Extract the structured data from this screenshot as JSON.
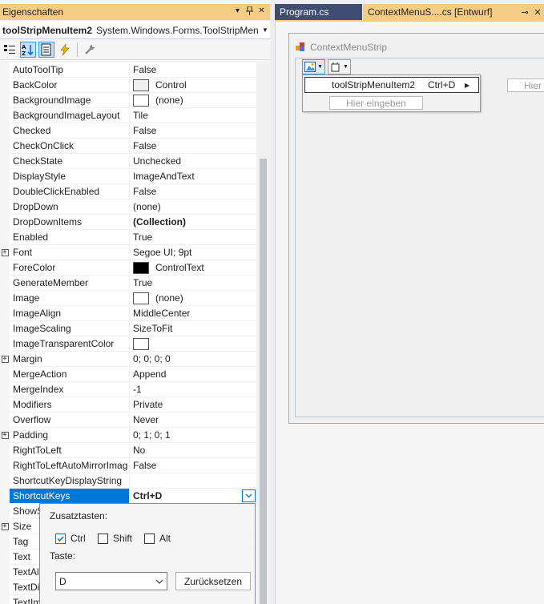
{
  "props_panel": {
    "title": "Eigenschaften",
    "object_name": "toolStripMenuItem2",
    "object_type": "System.Windows.Forms.ToolStripMen",
    "toolbar": [
      "categorized-icon",
      "alphabetical-icon",
      "properties-icon",
      "events-icon",
      "property-pages-icon"
    ],
    "rows": [
      {
        "name": "AutoToolTip",
        "value": "False"
      },
      {
        "name": "BackColor",
        "value": "Control",
        "swatch": "#f0f0f0"
      },
      {
        "name": "BackgroundImage",
        "value": "(none)",
        "swatch": "#ffffff"
      },
      {
        "name": "BackgroundImageLayout",
        "value": "Tile"
      },
      {
        "name": "Checked",
        "value": "False"
      },
      {
        "name": "CheckOnClick",
        "value": "False"
      },
      {
        "name": "CheckState",
        "value": "Unchecked"
      },
      {
        "name": "DisplayStyle",
        "value": "ImageAndText"
      },
      {
        "name": "DoubleClickEnabled",
        "value": "False"
      },
      {
        "name": "DropDown",
        "value": "(none)"
      },
      {
        "name": "DropDownItems",
        "value": "(Collection)",
        "bold": true
      },
      {
        "name": "Enabled",
        "value": "True"
      },
      {
        "name": "Font",
        "value": "Segoe UI; 9pt",
        "expandable": true
      },
      {
        "name": "ForeColor",
        "value": "ControlText",
        "swatch": "#000000"
      },
      {
        "name": "GenerateMember",
        "value": "True"
      },
      {
        "name": "Image",
        "value": "(none)",
        "swatch": "#ffffff"
      },
      {
        "name": "ImageAlign",
        "value": "MiddleCenter"
      },
      {
        "name": "ImageScaling",
        "value": "SizeToFit"
      },
      {
        "name": "ImageTransparentColor",
        "value": "",
        "swatch": "#ffffff"
      },
      {
        "name": "Margin",
        "value": "0; 0; 0; 0",
        "expandable": true
      },
      {
        "name": "MergeAction",
        "value": "Append"
      },
      {
        "name": "MergeIndex",
        "value": "-1"
      },
      {
        "name": "Modifiers",
        "value": "Private"
      },
      {
        "name": "Overflow",
        "value": "Never"
      },
      {
        "name": "Padding",
        "value": "0; 1; 0; 1",
        "expandable": true
      },
      {
        "name": "RightToLeft",
        "value": "No"
      },
      {
        "name": "RightToLeftAutoMirrorImag",
        "value": "False"
      },
      {
        "name": "ShortcutKeyDisplayString",
        "value": ""
      },
      {
        "name": "ShortcutKeys",
        "value": "Ctrl+D",
        "selected": true
      },
      {
        "name": "ShowS",
        "value": ""
      },
      {
        "name": "Size",
        "value": "",
        "expandable": true
      },
      {
        "name": "Tag",
        "value": ""
      },
      {
        "name": "Text",
        "value": ""
      },
      {
        "name": "TextAl",
        "value": ""
      },
      {
        "name": "TextDi",
        "value": ""
      },
      {
        "name": "TextIm",
        "value": ""
      }
    ]
  },
  "shortcut_editor": {
    "modifiers_label": "Zusatztasten:",
    "ctrl_label": "Ctrl",
    "ctrl_checked": true,
    "shift_label": "Shift",
    "shift_checked": false,
    "alt_label": "Alt",
    "alt_checked": false,
    "key_label": "Taste:",
    "key_value": "D",
    "reset_label": "Zurücksetzen"
  },
  "tabs": [
    {
      "label": "Program.cs",
      "active": false
    },
    {
      "label": "ContextMenuS....cs [Entwurf]",
      "active": true
    }
  ],
  "designer": {
    "form_title": "ContextMenuStrip",
    "menu_item_text": "toolStripMenuItem2",
    "menu_item_shortcut": "Ctrl+D",
    "type_here": "Hier eingeben",
    "type_here_short": "Hier"
  },
  "colors": {
    "title_bar": "#f5cc84",
    "selection": "#0078d7",
    "inactive_tab": "#3f4e70"
  }
}
